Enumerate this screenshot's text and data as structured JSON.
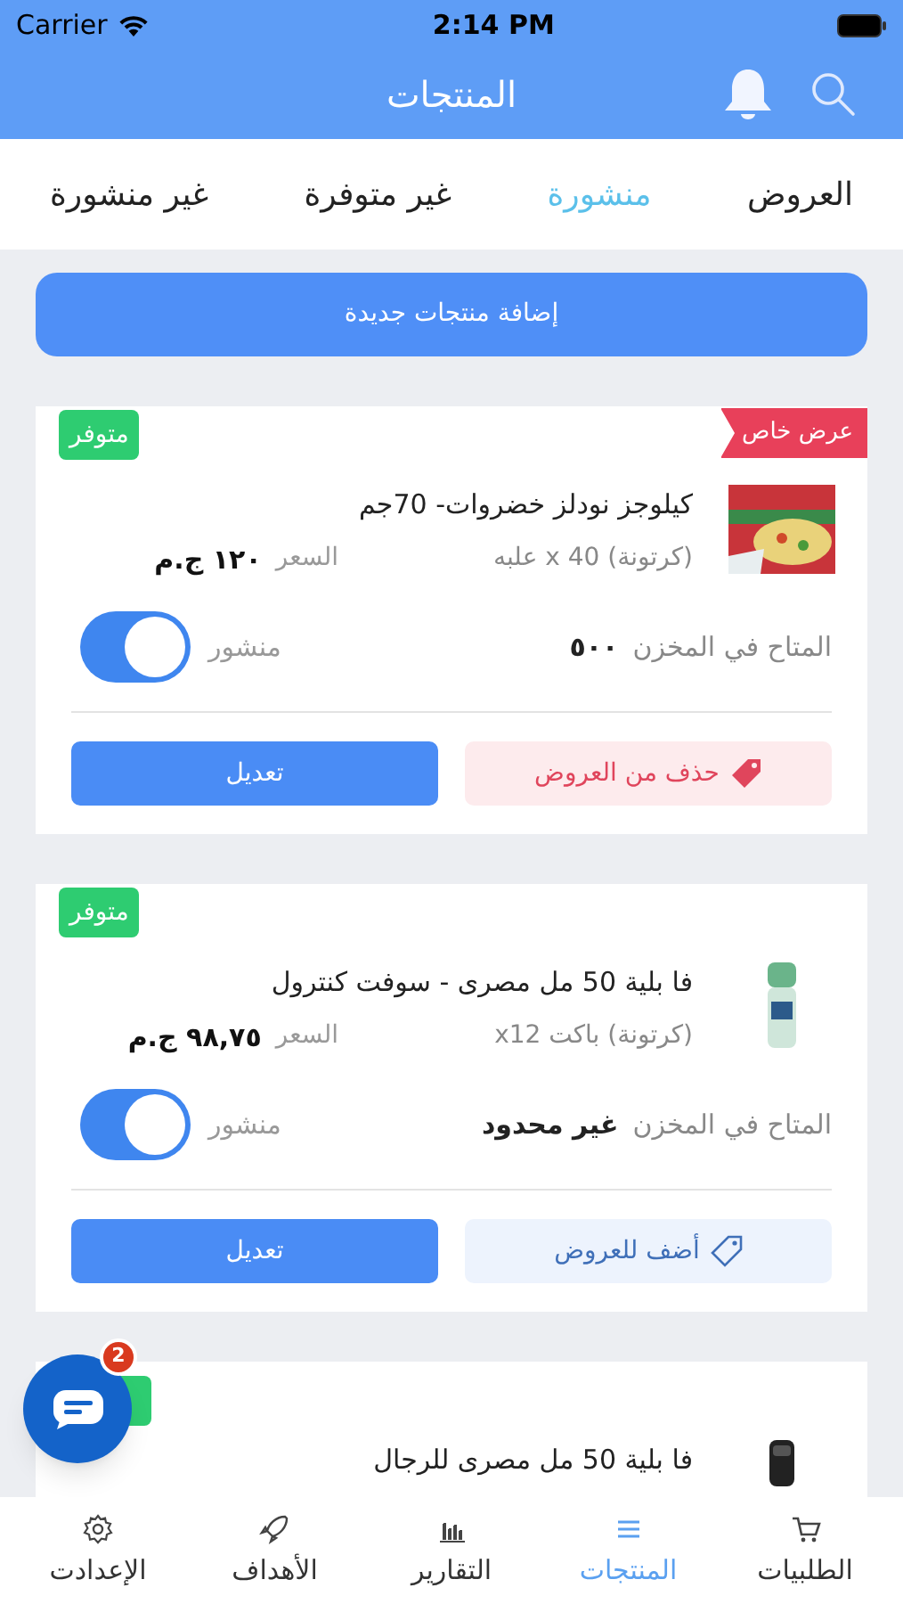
{
  "status_bar": {
    "carrier": "Carrier",
    "time": "2:14 PM"
  },
  "header": {
    "title": "المنتجات"
  },
  "tabs": [
    {
      "label": "العروض",
      "selected": false
    },
    {
      "label": "منشورة",
      "selected": true
    },
    {
      "label": "غير متوفرة",
      "selected": false
    },
    {
      "label": "غير منشورة",
      "selected": false
    }
  ],
  "add_button": "إضافة منتجات جديدة",
  "products": [
    {
      "status": "متوفر",
      "offer_ribbon": "عرض خاص",
      "name": "كيلوجز نودلز خضروات- 70جم",
      "package": "(كرتونة) 40 x علبه",
      "price_label": "السعر",
      "price": "١٢٠ ج.م",
      "stock_label": "المتاح في المخزن",
      "stock": "٥٠٠",
      "published_label": "منشور",
      "published": true,
      "offer_action": {
        "kind": "remove",
        "label": "حذف من العروض"
      },
      "edit": "تعديل"
    },
    {
      "status": "متوفر",
      "name": "فا بلية 50 مل مصرى - سوفت كنترول",
      "package": "(كرتونة) باكت x12",
      "price_label": "السعر",
      "price": "٩٨,٧٥ ج.م",
      "stock_label": "المتاح في المخزن",
      "stock": "غير محدود",
      "published_label": "منشور",
      "published": true,
      "offer_action": {
        "kind": "add",
        "label": "أضف للعروض"
      },
      "edit": "تعديل"
    },
    {
      "name": "فا بلية 50 مل مصرى للرجال"
    }
  ],
  "chat": {
    "badge": "2"
  },
  "bottom_nav": [
    {
      "label": "الطلبيات",
      "selected": false
    },
    {
      "label": "المنتجات",
      "selected": true
    },
    {
      "label": "التقارير",
      "selected": false
    },
    {
      "label": "الأهداف",
      "selected": false
    },
    {
      "label": "الإعدادت",
      "selected": false
    }
  ]
}
